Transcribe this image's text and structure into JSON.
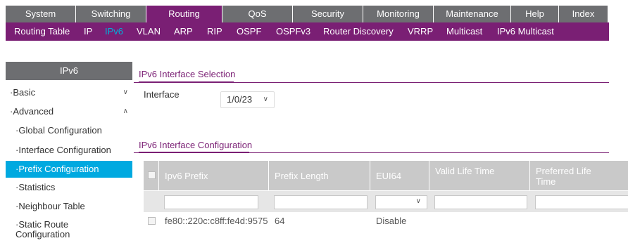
{
  "topnav": {
    "tabs": [
      {
        "label": "System"
      },
      {
        "label": "Switching"
      },
      {
        "label": "Routing"
      },
      {
        "label": "QoS"
      },
      {
        "label": "Security"
      },
      {
        "label": "Monitoring"
      },
      {
        "label": "Maintenance"
      },
      {
        "label": "Help"
      },
      {
        "label": "Index"
      }
    ],
    "active_tab": "Routing",
    "subtabs": [
      {
        "label": "Routing Table"
      },
      {
        "label": "IP"
      },
      {
        "label": "IPv6"
      },
      {
        "label": "VLAN"
      },
      {
        "label": "ARP"
      },
      {
        "label": "RIP"
      },
      {
        "label": "OSPF"
      },
      {
        "label": "OSPFv3"
      },
      {
        "label": "Router Discovery"
      },
      {
        "label": "VRRP"
      },
      {
        "label": "Multicast"
      },
      {
        "label": "IPv6 Multicast"
      }
    ],
    "active_subtab": "IPv6"
  },
  "sidebar": {
    "header": "IPv6",
    "items": [
      {
        "label": "Basic"
      },
      {
        "label": "Advanced"
      },
      {
        "label": "Global Configuration"
      },
      {
        "label": "Interface Configuration"
      },
      {
        "label": "Prefix Configuration"
      },
      {
        "label": "Statistics"
      },
      {
        "label": "Neighbour Table"
      },
      {
        "label": "Static Route Configuration"
      }
    ]
  },
  "selection": {
    "title": "IPv6 Interface Selection",
    "interface_label": "Interface",
    "interface_value": "1/0/23"
  },
  "config": {
    "title": "IPv6 Interface Configuration",
    "columns": [
      {
        "label": "Ipv6 Prefix"
      },
      {
        "label": "Prefix Length"
      },
      {
        "label": "EUI64"
      },
      {
        "label": "Valid Life Time"
      },
      {
        "label": "Preferred Life Time"
      }
    ],
    "rows": [
      {
        "prefix": "fe80::220c:c8ff:fe4d:9575",
        "length": "64",
        "eui64": "Disable",
        "valid": "",
        "preferred": ""
      }
    ]
  },
  "colors": {
    "brand_purple": "#7a1f74",
    "nav_gray": "#6d6e71",
    "active_blue": "#00a9e0",
    "grid_header": "#c9c9c9"
  }
}
